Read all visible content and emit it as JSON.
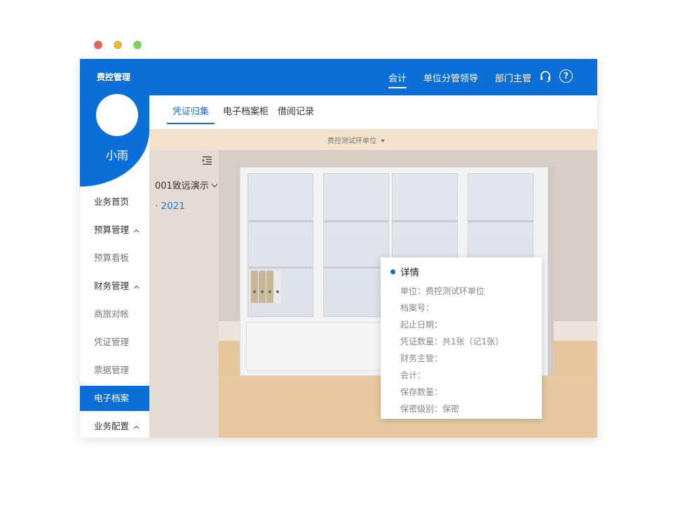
{
  "app_title": "费控管理",
  "top_nav": [
    {
      "label": "会计",
      "active": true
    },
    {
      "label": "单位分管领导",
      "active": false
    },
    {
      "label": "部门主管",
      "active": false
    }
  ],
  "icons": {
    "support": "headset-icon",
    "help": "help-icon",
    "help_glyph": "?"
  },
  "user": {
    "name": "小雨"
  },
  "sidebar": {
    "items": [
      {
        "label": "业务首页"
      },
      {
        "label": "预算管理"
      },
      {
        "label": "预算看板"
      },
      {
        "label": "财务管理"
      },
      {
        "label": "商旅对帐"
      },
      {
        "label": "凭证管理"
      },
      {
        "label": "票据管理"
      },
      {
        "label": "电子档案"
      },
      {
        "label": "业务配置"
      }
    ]
  },
  "tabs": [
    {
      "label": "凭证归集",
      "active": true
    },
    {
      "label": "电子档案柜",
      "active": false
    },
    {
      "label": "借阅记录",
      "active": false
    }
  ],
  "unit_selector": {
    "value": "费控测试环单位"
  },
  "tree": {
    "node": "001致远演示",
    "leaf": "· 2021"
  },
  "detail": {
    "title": "详情",
    "rows": [
      "单位：费控测试环单位",
      "档案号：",
      "起止日期：",
      "凭证数量：共1张（记1张）",
      "财务主管：",
      "会计：",
      "保存数量：",
      "保密级别：保密"
    ]
  },
  "colors": {
    "primary": "#0c6fd8",
    "wall": "#d7cdc4",
    "floor": "#e8c9a0",
    "panel": "#e4dcd2"
  }
}
